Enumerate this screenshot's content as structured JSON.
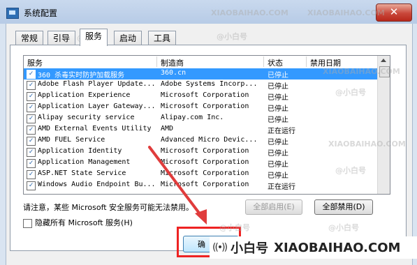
{
  "window": {
    "title": "系统配置",
    "close_glyph": "✕"
  },
  "tabs": [
    {
      "label": "常规",
      "active": false
    },
    {
      "label": "引导",
      "active": false
    },
    {
      "label": "服务",
      "active": true
    },
    {
      "label": "启动",
      "active": false
    },
    {
      "label": "工具",
      "active": false
    }
  ],
  "columns": {
    "service": "服务",
    "manufacturer": "制造商",
    "status": "状态",
    "disabled_date": "禁用日期"
  },
  "services": [
    {
      "name": "360 杀毒实时防护加载服务",
      "manufacturer": "360.cn",
      "status": "已停止",
      "checked": true,
      "selected": true
    },
    {
      "name": "Adobe Flash Player Update...",
      "manufacturer": "Adobe Systems Incorp...",
      "status": "已停止",
      "checked": true,
      "selected": false
    },
    {
      "name": "Application Experience",
      "manufacturer": "Microsoft Corporation",
      "status": "已停止",
      "checked": true,
      "selected": false
    },
    {
      "name": "Application Layer Gateway...",
      "manufacturer": "Microsoft Corporation",
      "status": "已停止",
      "checked": true,
      "selected": false
    },
    {
      "name": "Alipay security service",
      "manufacturer": "Alipay.com Inc.",
      "status": "已停止",
      "checked": true,
      "selected": false
    },
    {
      "name": "AMD External Events Utility",
      "manufacturer": "AMD",
      "status": "正在运行",
      "checked": true,
      "selected": false
    },
    {
      "name": "AMD FUEL Service",
      "manufacturer": "Advanced Micro Devic...",
      "status": "已停止",
      "checked": true,
      "selected": false
    },
    {
      "name": "Application Identity",
      "manufacturer": "Microsoft Corporation",
      "status": "已停止",
      "checked": true,
      "selected": false
    },
    {
      "name": "Application Management",
      "manufacturer": "Microsoft Corporation",
      "status": "已停止",
      "checked": true,
      "selected": false
    },
    {
      "name": "ASP.NET State Service",
      "manufacturer": "Microsoft Corporation",
      "status": "已停止",
      "checked": true,
      "selected": false
    },
    {
      "name": "Windows Audio Endpoint Bu...",
      "manufacturer": "Microsoft Corporation",
      "status": "正在运行",
      "checked": true,
      "selected": false
    }
  ],
  "note": "请注意，某些 Microsoft 安全服务可能无法禁用。",
  "buttons": {
    "enable_all": "全部启用(E)",
    "disable_all": "全部禁用(D)",
    "ok": "确"
  },
  "hide_microsoft": {
    "label": "隐藏所有 Microsoft 服务(H)",
    "checked": false
  },
  "watermark": {
    "domain": "XIAOBAIHAO.COM",
    "cn": "@小白号"
  },
  "brand": {
    "icon": "((•))",
    "name": "小白号",
    "domain": "XIAOBAIHAO.COM"
  },
  "colors": {
    "selection": "#3399ff",
    "highlight_box": "#e22222",
    "arrow": "#e03c3c"
  }
}
